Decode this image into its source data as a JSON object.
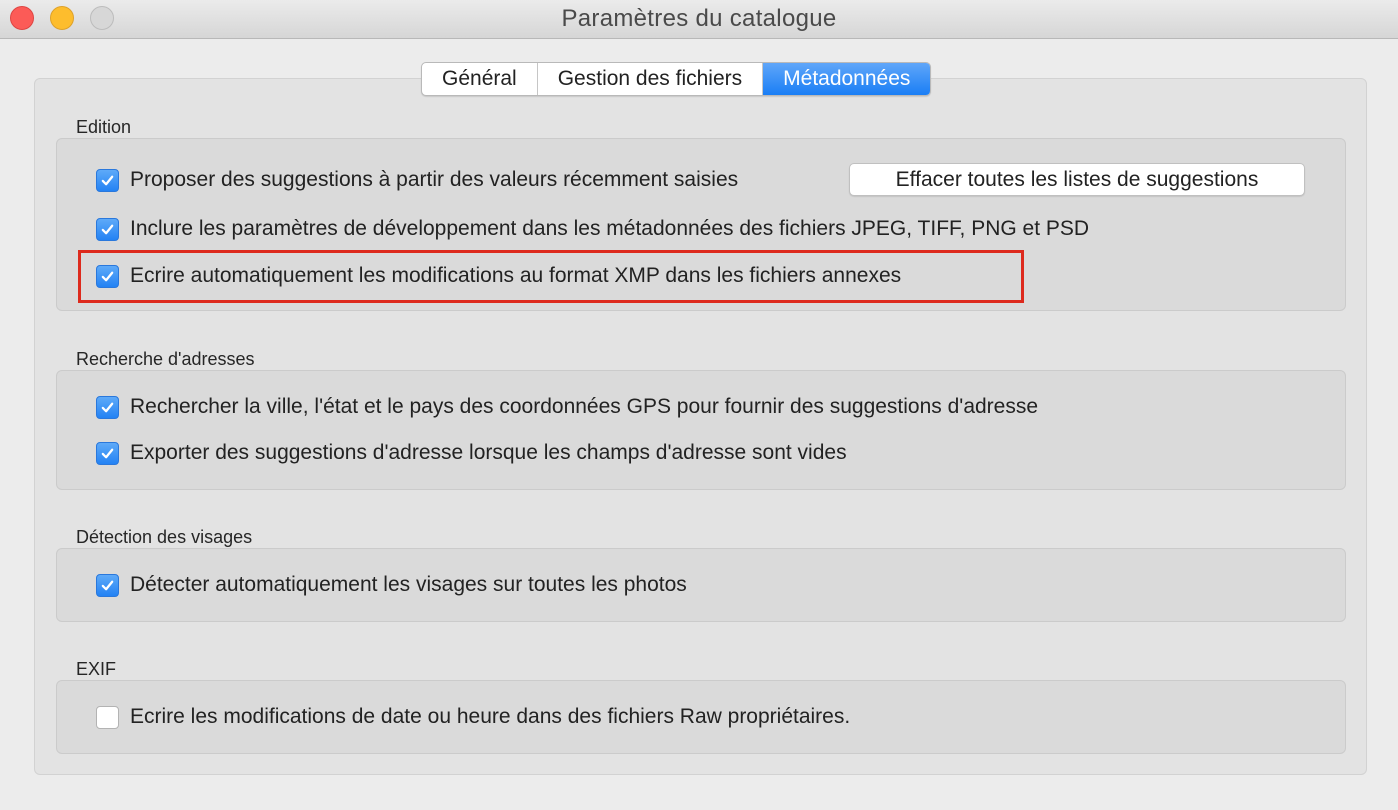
{
  "window": {
    "title": "Paramètres du catalogue"
  },
  "tabs": [
    {
      "label": "Général",
      "active": false
    },
    {
      "label": "Gestion des fichiers",
      "active": false
    },
    {
      "label": "Métadonnées",
      "active": true
    }
  ],
  "sections": {
    "edition": {
      "title": "Edition",
      "items": [
        {
          "label": "Proposer des suggestions à partir des valeurs récemment saisies",
          "checked": true
        },
        {
          "label": "Inclure les paramètres de développement dans les métadonnées des fichiers JPEG, TIFF, PNG et PSD",
          "checked": true
        },
        {
          "label": "Ecrire automatiquement les modifications au format XMP dans les fichiers annexes",
          "checked": true
        }
      ],
      "clear_button": "Effacer toutes les listes de suggestions"
    },
    "address": {
      "title": "Recherche d'adresses",
      "items": [
        {
          "label": "Rechercher la ville, l'état et le pays des coordonnées GPS pour fournir des suggestions d'adresse",
          "checked": true
        },
        {
          "label": "Exporter des suggestions d'adresse lorsque les champs d'adresse sont vides",
          "checked": true
        }
      ]
    },
    "faces": {
      "title": "Détection des visages",
      "items": [
        {
          "label": "Détecter automatiquement les visages sur toutes les photos",
          "checked": true
        }
      ]
    },
    "exif": {
      "title": "EXIF",
      "items": [
        {
          "label": "Ecrire les modifications de date ou heure dans des fichiers Raw propriétaires.",
          "checked": false
        }
      ]
    }
  },
  "colors": {
    "accent": "#2382f4",
    "highlight_border": "#dd2a1d"
  },
  "icons": {
    "checkmark": "checkmark-icon"
  }
}
